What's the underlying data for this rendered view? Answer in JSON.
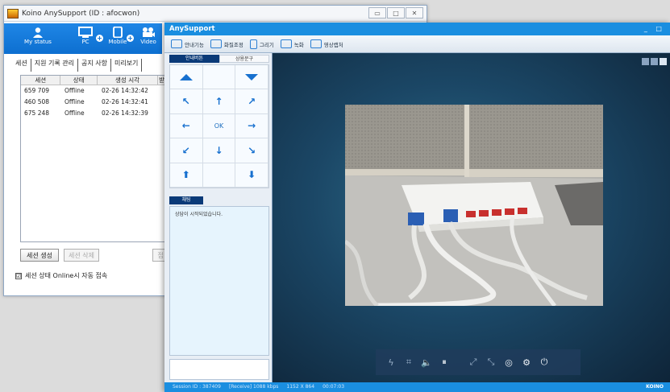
{
  "left_window": {
    "title": "Koino AnySupport",
    "id_label": "(ID : afocwon)",
    "toolbar": {
      "my_status": "My status",
      "pc": "PC",
      "mobile": "Mobile",
      "video": "Video"
    },
    "tabs": [
      "세션",
      "지원 기록 관리",
      "공지 사항",
      "미리보기"
    ],
    "session_columns": [
      "세션",
      "상태",
      "생성 시각",
      "받"
    ],
    "sessions": [
      {
        "id": "659 709",
        "status": "Offline",
        "time": "02-26 14:32:42"
      },
      {
        "id": "460 508",
        "status": "Offline",
        "time": "02-26 14:32:41"
      },
      {
        "id": "675 248",
        "status": "Offline",
        "time": "02-26 14:32:39"
      }
    ],
    "create_button": "세션 생성",
    "delete_button": "세션 삭제",
    "extra_button": "접",
    "auto_connect_label": "세션 상태 Online시 자동 접속",
    "auto_connect_checked": "☑"
  },
  "right_window": {
    "title": "AnySupport",
    "window_controls": "_ □",
    "toolbar": [
      "안내기능",
      "화질조정",
      "그리기",
      "녹화",
      "영상캡처"
    ],
    "side_tabs": [
      "안내버튼",
      "상용문구"
    ],
    "dpad_ok": "OK",
    "chat_tab": "채팅",
    "chat_message": "상담이 시작되었습니다.",
    "status_bar": {
      "session": "Session ID : 387409",
      "receive": "[Receive] 1088 kbps",
      "resolution": "1152 X 864",
      "elapsed": "00:07:03",
      "brand": "KOINO"
    }
  },
  "colors": {
    "accent": "#1a8ee0",
    "toolbar_blue": "#0d6fd0",
    "dark_tab": "#0a3a78"
  }
}
